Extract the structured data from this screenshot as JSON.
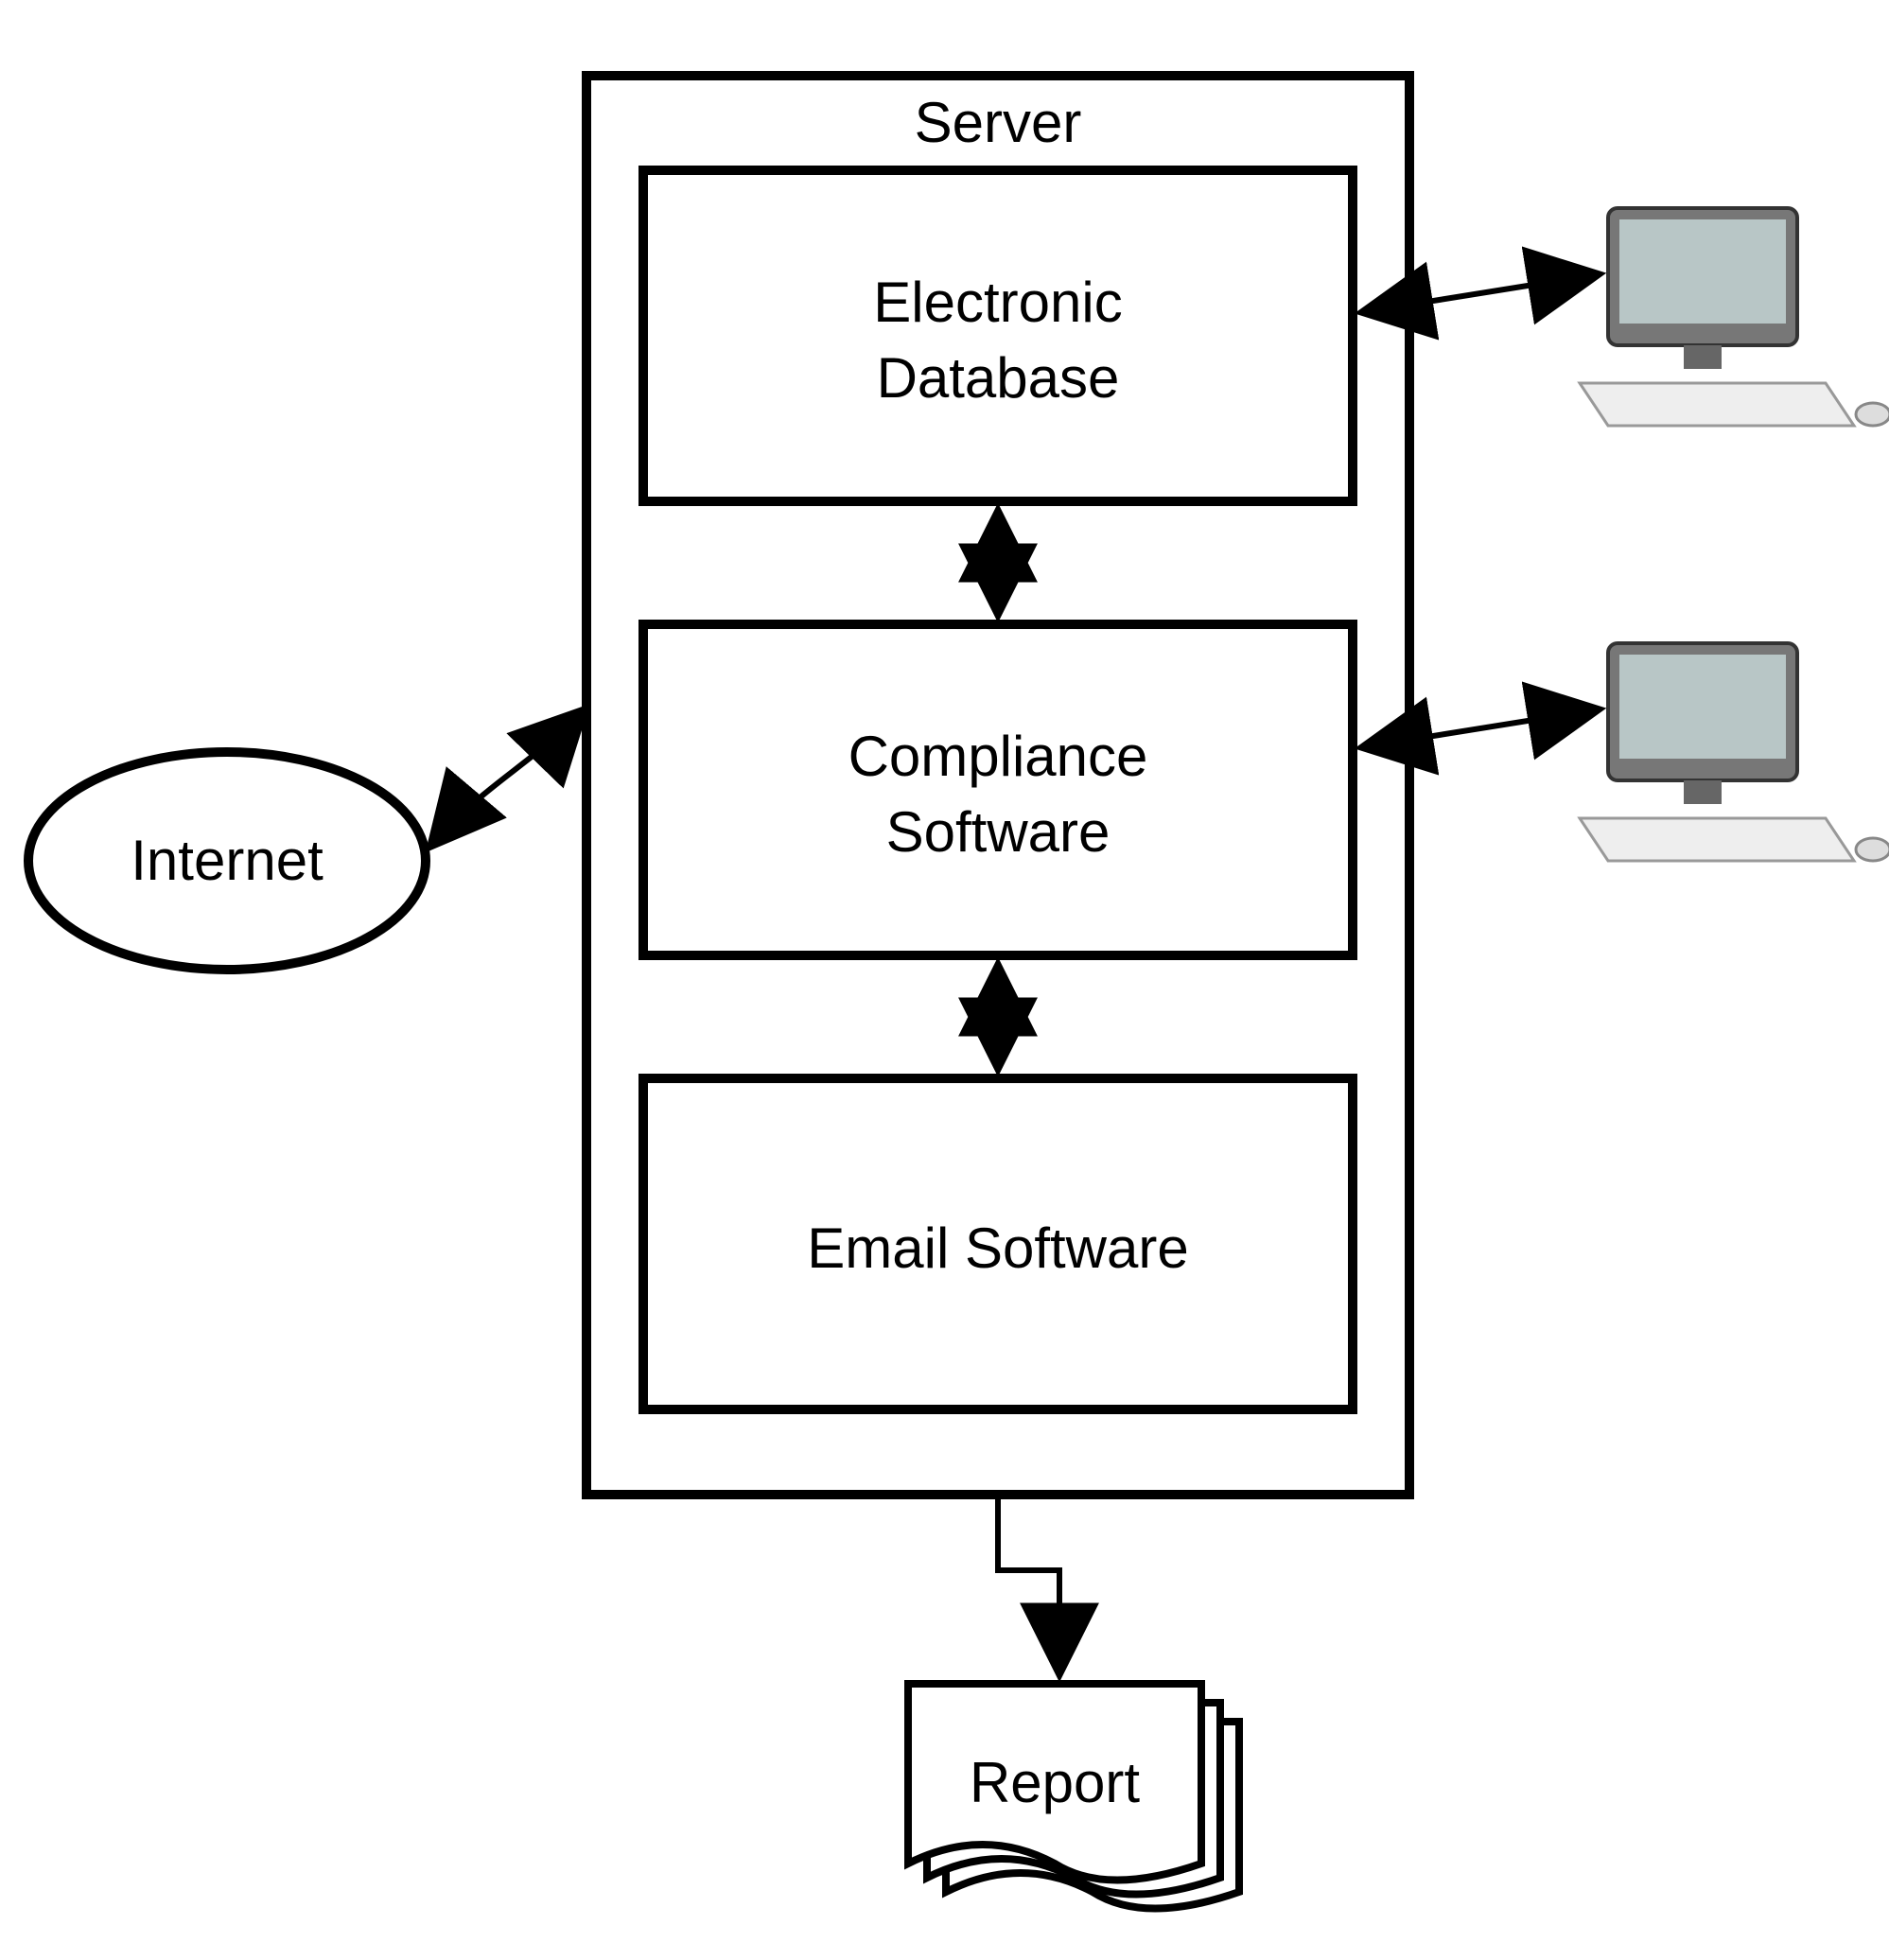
{
  "diagram": {
    "server_title": "Server",
    "boxes": {
      "db_line1": "Electronic",
      "db_line2": "Database",
      "compliance_line1": "Compliance",
      "compliance_line2": "Software",
      "email_line1": "Email Software"
    },
    "internet_label": "Internet",
    "report_label": "Report"
  }
}
